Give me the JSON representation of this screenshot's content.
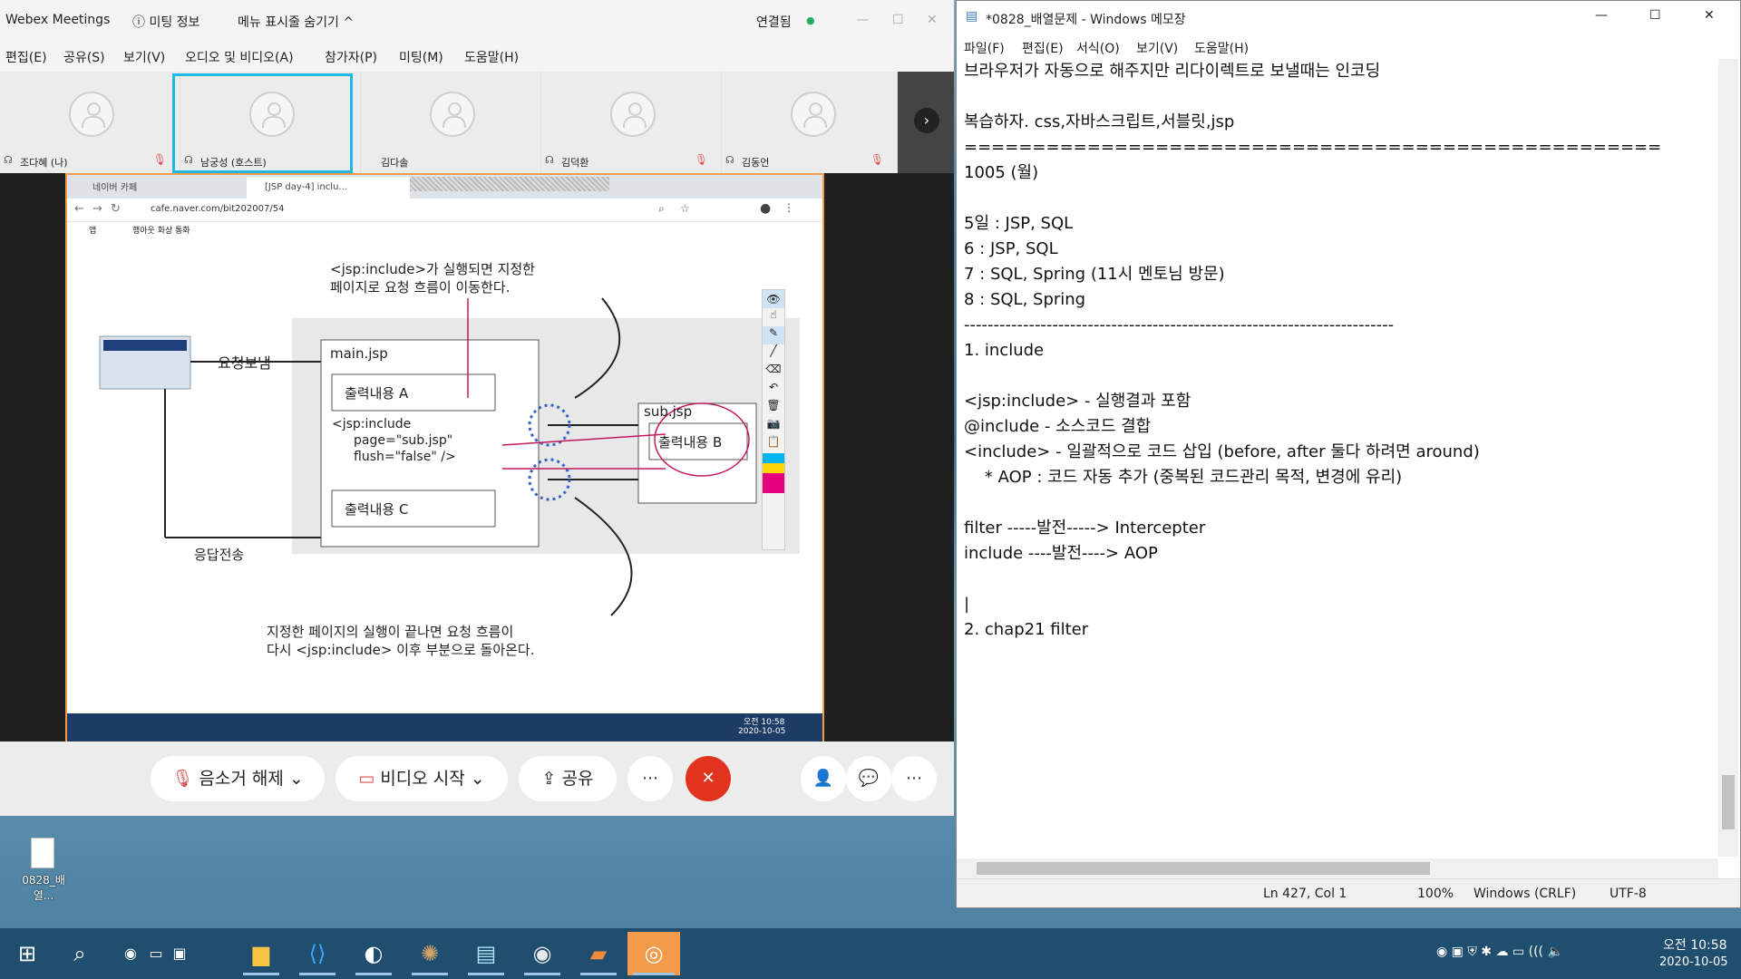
{
  "webex": {
    "title": "Webex Meetings",
    "meeting_info": "ⓘ 미팅 정보",
    "hide_menu": "메뉴 표시줄 숨기기 ^",
    "connected": "연결됨",
    "menu": [
      "편집(E)",
      "공유(S)",
      "보기(V)",
      "오디오 및 비디오(A)",
      "참가자(P)",
      "미팅(M)",
      "도움말(H)"
    ],
    "participants": [
      {
        "name": "조다혜 (나)",
        "muted": true
      },
      {
        "name": "남궁성 (호스트)",
        "muted": false
      },
      {
        "name": "김다솔",
        "muted": false
      },
      {
        "name": "김덕환",
        "muted": true
      },
      {
        "name": "김동언",
        "muted": true
      }
    ],
    "controls": {
      "mute": "음소거 해제",
      "video": "비디오 시작",
      "share": "공유"
    }
  },
  "browser": {
    "tabs": [
      "네이버 카페",
      "[JSP day-4] inclu..."
    ],
    "url": "cafe.naver.com/bit202007/54",
    "bookmarks": [
      "앱",
      "행아웃 화상 통화"
    ]
  },
  "diagram": {
    "top_note": [
      "<jsp:include>가 실행되면 지정한",
      "페이지로 요청 흐름이 이동한다."
    ],
    "send_request": "요청보냄",
    "main_file": "main.jsp",
    "out_a": "출력내용 A",
    "include_code": [
      "<jsp:include",
      "page=\"sub.jsp\"",
      "flush=\"false\" />"
    ],
    "out_c": "출력내용 C",
    "sub_file": "sub.jsp",
    "out_b": "출력내용 B",
    "response": "응답전송",
    "bottom_note": [
      "지정한 페이지의 실행이 끝나면 요청 흐름이",
      "다시 <jsp:include> 이후 부분으로 돌아온다."
    ]
  },
  "inner_clock": {
    "time": "오전 10:58",
    "date": "2020-10-05"
  },
  "notepad": {
    "title": "*0828_배열문제 - Windows 메모장",
    "menu": [
      "파일(F)",
      "편집(E)",
      "서식(O)",
      "보기(V)",
      "도움말(H)"
    ],
    "lines": [
      "브라우저가 자동으로 해주지만 리다이렉트로 보낼때는 인코딩",
      "",
      "복습하자. css,자바스크립트,서블릿,jsp",
      "===================================================",
      "1005 (월)",
      "",
      "5일 : JSP, SQL",
      "6 : JSP, SQL",
      "7 : SQL, Spring (11시 멘토님 방문)",
      "8 : SQL, Spring",
      "-------------------------------------------------------------------------",
      "1. include",
      "",
      "<jsp:include> - 실행결과 포함",
      "@include - 소스코드 결합",
      "<include> - 일괄적으로 코드 삽입 (before, after 둘다 하려면 around)",
      "    * AOP : 코드 자동 추가 (중복된 코드관리 목적, 변경에 유리)",
      "",
      "filter -----발전-----> Intercepter",
      "include ----발전----> AOP",
      "",
      "|",
      "2. chap21 filter"
    ],
    "status": {
      "pos": "Ln 427, Col 1",
      "zoom": "100%",
      "eol": "Windows (CRLF)",
      "enc": "UTF-8"
    }
  },
  "desktop_icon": "0828_배열...",
  "clock": {
    "time": "오전 10:58",
    "date": "2020-10-05"
  }
}
